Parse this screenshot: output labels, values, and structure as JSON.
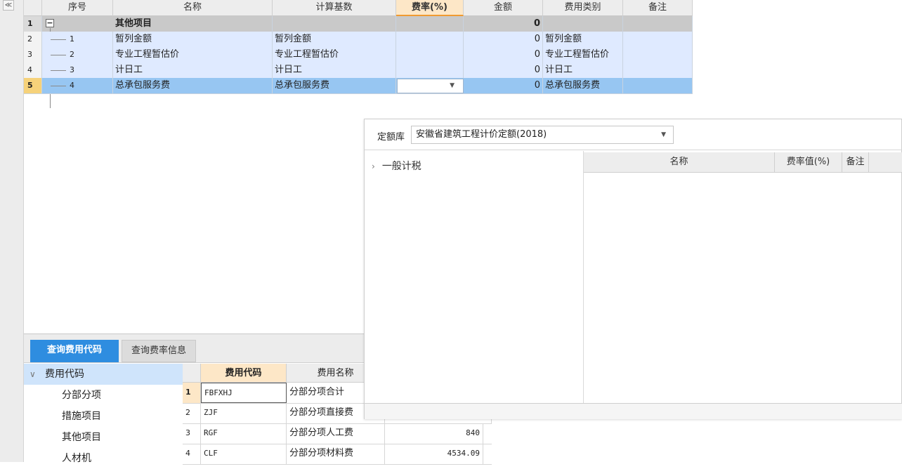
{
  "toolbar": {
    "collapse_glyph": "≪"
  },
  "main_grid": {
    "columns": [
      "序号",
      "名称",
      "计算基数",
      "费率(%)",
      "金额",
      "费用类别",
      "备注"
    ],
    "active_column": "费率(%)",
    "rows": [
      {
        "row": "1",
        "seq": "",
        "name": "其他项目",
        "base": "",
        "rate": "",
        "amount": "0",
        "category": "",
        "note": ""
      },
      {
        "row": "2",
        "seq": "1",
        "name": "暂列金额",
        "base": "暂列金额",
        "rate": "",
        "amount": "0",
        "category": "暂列金额",
        "note": ""
      },
      {
        "row": "3",
        "seq": "2",
        "name": "专业工程暂估价",
        "base": "专业工程暂估价",
        "rate": "",
        "amount": "0",
        "category": "专业工程暂估价",
        "note": ""
      },
      {
        "row": "4",
        "seq": "3",
        "name": "计日工",
        "base": "计日工",
        "rate": "",
        "amount": "0",
        "category": "计日工",
        "note": ""
      },
      {
        "row": "5",
        "seq": "4",
        "name": "总承包服务费",
        "base": "总承包服务费",
        "rate": "",
        "amount": "0",
        "category": "总承包服务费",
        "note": ""
      }
    ],
    "expander_glyph": "−"
  },
  "popup": {
    "library_label": "定额库",
    "library_value": "安徽省建筑工程计价定额(2018)",
    "tree": [
      {
        "label": "一般计税"
      }
    ],
    "columns": [
      "名称",
      "费率值(%)",
      "备注"
    ]
  },
  "bottom": {
    "tabs": [
      {
        "label": "查询费用代码",
        "active": true
      },
      {
        "label": "查询费率信息",
        "active": false
      }
    ],
    "code_tree": {
      "root": "费用代码",
      "items": [
        "分部分项",
        "措施项目",
        "其他项目",
        "人材机"
      ]
    },
    "code_grid": {
      "columns": [
        "费用代码",
        "费用名称"
      ],
      "rows": [
        {
          "row": "1",
          "code": "FBFXHJ",
          "name": "分部分项合计",
          "value": ""
        },
        {
          "row": "2",
          "code": "ZJF",
          "name": "分部分项直接费",
          "value": ""
        },
        {
          "row": "3",
          "code": "RGF",
          "name": "分部分项人工费",
          "value": "840"
        },
        {
          "row": "4",
          "code": "CLF",
          "name": "分部分项材料费",
          "value": "4534.09"
        }
      ]
    }
  },
  "colors": {
    "selected_row": "#97c6f2",
    "child_row": "#dfeaff",
    "active_tab": "#2e8de0",
    "active_header": "#fde7c7"
  }
}
